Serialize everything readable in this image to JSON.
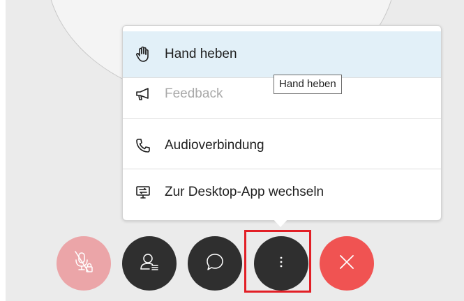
{
  "menu": {
    "items": [
      {
        "label": "Hand heben",
        "icon": "hand-icon",
        "state": "highlighted"
      },
      {
        "label": "Feedback",
        "icon": "megaphone-icon",
        "state": "disabled"
      },
      {
        "label": "Audioverbindung",
        "icon": "phone-icon",
        "state": "normal"
      },
      {
        "label": "Zur Desktop-App wechseln",
        "icon": "desktop-app-icon",
        "state": "normal"
      }
    ]
  },
  "tooltip": {
    "text": "Hand heben"
  },
  "controls": {
    "buttons": [
      {
        "name": "mute",
        "icon": "microphone-muted-locked-icon",
        "color": "#eba5a8"
      },
      {
        "name": "participants",
        "icon": "participants-icon",
        "color": "#2f2f2f"
      },
      {
        "name": "chat",
        "icon": "chat-bubble-icon",
        "color": "#2f2f2f"
      },
      {
        "name": "more",
        "icon": "more-vertical-icon",
        "color": "#2f2f2f",
        "selected": true
      },
      {
        "name": "leave",
        "icon": "close-icon",
        "color": "#f05352"
      }
    ]
  },
  "colors": {
    "highlight_border": "#e21f26",
    "active_item_background": "#e2f0f8",
    "disabled_text": "#a9a9a9"
  }
}
